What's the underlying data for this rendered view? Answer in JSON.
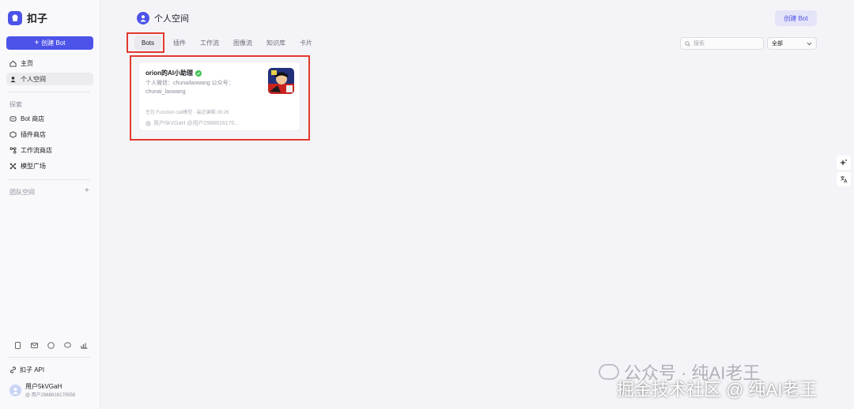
{
  "brand": {
    "name": "扣子"
  },
  "sidebar": {
    "create_label": "创建 Bot",
    "nav": [
      {
        "label": "主页",
        "icon": "home-icon"
      },
      {
        "label": "个人空间",
        "icon": "user-icon"
      }
    ],
    "explore_label": "探索",
    "explore": [
      {
        "label": "Bot 商店",
        "icon": "bot-icon"
      },
      {
        "label": "插件商店",
        "icon": "plugin-icon"
      },
      {
        "label": "工作流商店",
        "icon": "workflow-icon"
      },
      {
        "label": "模型广场",
        "icon": "model-icon"
      }
    ],
    "team_label": "团队空间",
    "api_label": "扣子 API",
    "user": {
      "name": "用户5kVGaH",
      "id": "@ 用户2968816170558"
    }
  },
  "header": {
    "title": "个人空间",
    "create_label": "创建 Bot"
  },
  "tabs": [
    "Bots",
    "插件",
    "工作流",
    "图像流",
    "知识库",
    "卡片"
  ],
  "search": {
    "placeholder": "搜索"
  },
  "filter": {
    "value": "全部"
  },
  "bot_card": {
    "name": "orion的AI小助理",
    "description": "个人微信：chunailaowang 公众号：chunai_laowang",
    "meta": "豆包 Function call模型 · 最近编辑 09:26",
    "owner": "用户5kVGaH @用户2968816170..."
  },
  "watermark": {
    "line1": "公众号 · 纯AI老王",
    "line2": "掘金技术社区 @ 纯AI老王"
  },
  "colors": {
    "accent": "#4d53e8",
    "highlight": "#e23a2e",
    "verified": "#3ec254"
  }
}
